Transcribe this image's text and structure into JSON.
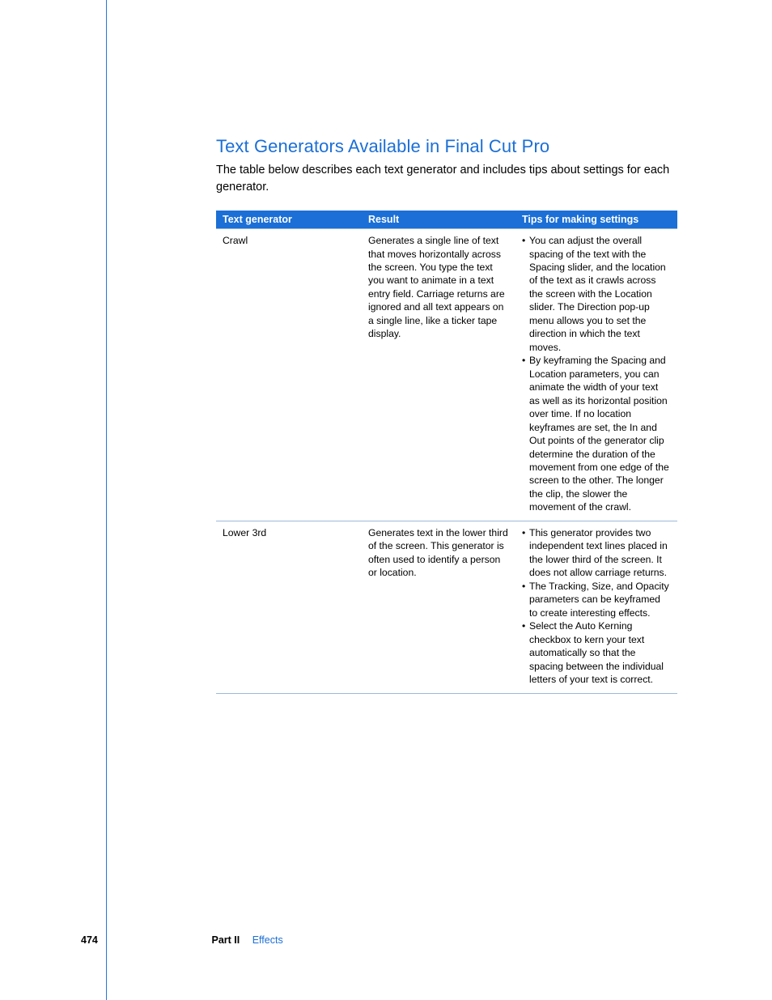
{
  "heading": "Text Generators Available in Final Cut Pro",
  "intro": "The table below describes each text generator and includes tips about settings for each generator.",
  "table": {
    "headers": {
      "generator": "Text generator",
      "result": "Result",
      "tips": "Tips for making settings"
    },
    "rows": [
      {
        "generator": "Crawl",
        "result": "Generates a single line of text that moves horizontally across the screen. You type the text you want to animate in a text entry field. Carriage returns are ignored and all text appears on a single line, like a ticker tape display.",
        "tips": [
          "You can adjust the overall spacing of the text with the Spacing slider, and the location of the text as it crawls across the screen with the Location slider. The Direction pop-up menu allows you to set the direction in which the text moves.",
          "By keyframing the Spacing and Location parameters, you can animate the width of your text as well as its horizontal position over time. If no location keyframes are set, the In and Out points of the generator clip determine the duration of the movement from one edge of the screen to the other. The longer the clip, the slower the movement of the crawl."
        ]
      },
      {
        "generator": "Lower 3rd",
        "result": "Generates text in the lower third of the screen. This generator is often used to identify a person or location.",
        "tips": [
          "This generator provides two independent text lines placed in the lower third of the screen. It does not allow carriage returns.",
          "The Tracking, Size, and Opacity parameters can be keyframed to create interesting effects.",
          "Select the Auto Kerning checkbox to kern your text automatically so that the spacing between the individual letters of your text is correct."
        ]
      }
    ]
  },
  "footer": {
    "page_number": "474",
    "part_label": "Part II",
    "chapter": "Effects"
  }
}
